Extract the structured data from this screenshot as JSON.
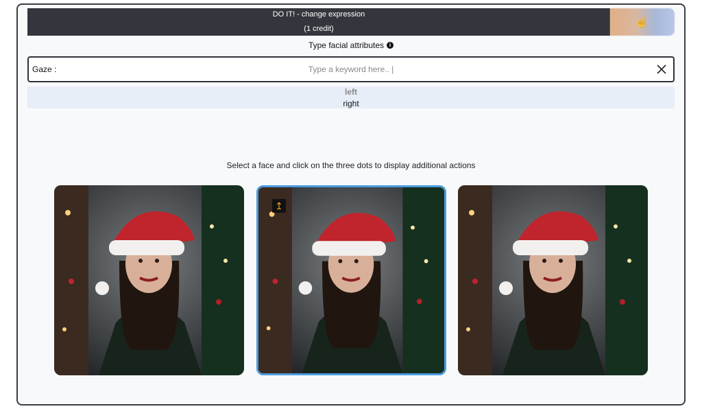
{
  "action": {
    "line1": "DO IT! - change expression",
    "line2": "(1 credit)"
  },
  "attributes": {
    "title": "Type facial attributes",
    "info_icon": "i"
  },
  "search": {
    "label": "Gaze :",
    "placeholder": "Type a keyword here.. |",
    "value": ""
  },
  "suggestions": [
    {
      "label": "left"
    },
    {
      "label": "right"
    }
  ],
  "hint": "Select a face and click on the three dots to display additional actions",
  "faces": [
    {
      "selected": false
    },
    {
      "selected": true
    },
    {
      "selected": false
    }
  ],
  "icons": {
    "upload": "↥",
    "hand": "☝"
  },
  "colors": {
    "action_bg": "#33373d",
    "selection": "#4a9be0",
    "suggestions_bg": "#e8eef8"
  }
}
